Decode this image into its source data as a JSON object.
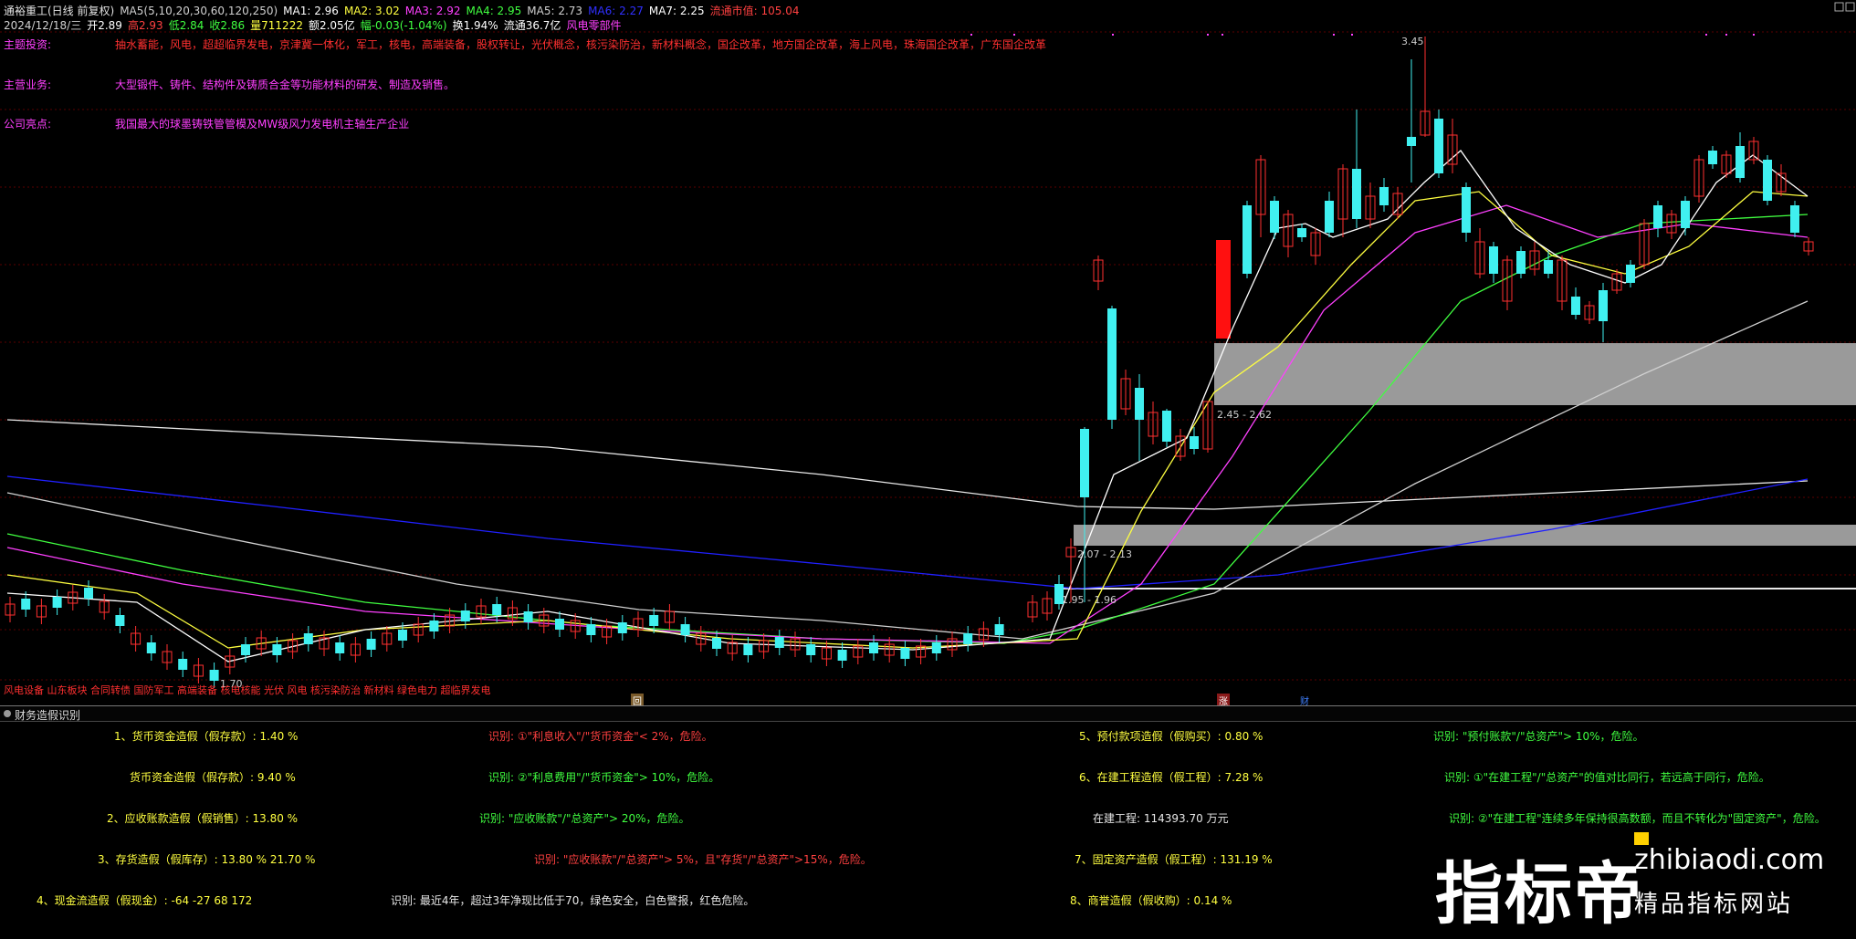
{
  "header": {
    "row1": [
      {
        "text": "通裕重工(日线 前复权)",
        "color": "#e0e0e0"
      },
      {
        "text": "MA5(5,10,20,30,60,120,250)",
        "color": "#d0d0d0"
      },
      {
        "text": "MA1: 2.96",
        "color": "#ffffff"
      },
      {
        "text": "MA2: 3.02",
        "color": "#ffff40"
      },
      {
        "text": "MA3: 2.92",
        "color": "#ff40ff"
      },
      {
        "text": "MA4: 2.95",
        "color": "#40ff40"
      },
      {
        "text": "MA5: 2.73",
        "color": "#d0d0d0"
      },
      {
        "text": "MA6: 2.27",
        "color": "#3030ff"
      },
      {
        "text": "MA7: 2.25",
        "color": "#ffffff"
      },
      {
        "text": "流通市值: 105.04",
        "color": "#ff4040"
      }
    ],
    "row2": [
      {
        "text": "2024/12/18/三",
        "color": "#d0d0d0"
      },
      {
        "text": "开2.89",
        "color": "#ffffff"
      },
      {
        "text": "高2.93",
        "color": "#ff4040"
      },
      {
        "text": "低2.84",
        "color": "#40ff40"
      },
      {
        "text": "收2.86",
        "color": "#40ff40"
      },
      {
        "text": "量711222",
        "color": "#ffff40"
      },
      {
        "text": "额2.05亿",
        "color": "#ffffff"
      },
      {
        "text": "幅-0.03(-1.04%)",
        "color": "#40ff40"
      },
      {
        "text": "换1.94%",
        "color": "#ffffff"
      },
      {
        "text": "流通36.7亿",
        "color": "#ffffff"
      },
      {
        "text": "风电零部件",
        "color": "#ff40ff"
      }
    ]
  },
  "info": {
    "theme_label": "主题投资:",
    "theme_text": "抽水蓄能，风电，超超临界发电，京津冀一体化，军工，核电，高端装备，股权转让，光伏概念，核污染防治，新材料概念，国企改革，地方国企改革，海上风电，珠海国企改革，广东国企改革",
    "business_label": "主营业务:",
    "business_text": "大型锻件、铸件、结构件及铸质合金等功能材料的研发、制造及销售。",
    "highlight_label": "公司亮点:",
    "highlight_text": "我国最大的球墨铸铁管管模及MW级风力发电机主轴生产企业"
  },
  "chart_tags": {
    "high": "3.45",
    "zone_upper": "2.45 - 2.62",
    "zone_middle": "2.07 - 2.13",
    "zone_lower": "1.95 - 1.96",
    "low": "1.70",
    "concepts": "风电设备 山东板块 合同转债 国防军工 高端装备 核电核能 光伏 风电 核污染防治 新材料 绿色电力 超临界发电",
    "tab_left": "回",
    "tab_mid": "涨",
    "tab_right": "财"
  },
  "finance": {
    "title": "财务造假识别",
    "r1c1": "1、货币资金造假（假存款）: 1.40 %",
    "r1c2": "识别: ①\"利息收入\"/\"货币资金\"< 2%，危险。",
    "r1c3": "5、预付款项造假（假购买）: 0.80 %",
    "r1c4": "识别: \"预付账款\"/\"总资产\"> 10%，危险。",
    "r2c1": "货币资金造假（假存款）: 9.40 %",
    "r2c2": "识别: ②\"利息费用\"/\"货币资金\"> 10%，危险。",
    "r2c3": "6、在建工程造假（假工程）: 7.28 %",
    "r2c4": "识别: ①\"在建工程\"/\"总资产\"的值对比同行，若远高于同行，危险。",
    "r3c1": "2、应收账款造假（假销售）: 13.80 %",
    "r3c2": "识别: \"应收账款\"/\"总资产\"> 20%，危险。",
    "r3c3": "在建工程: 114393.70 万元",
    "r3c4": "识别: ②\"在建工程\"连续多年保持很高数额，而且不转化为\"固定资产\"，危险。",
    "r4c1": "3、存货造假（假库存）: 13.80 %     21.70 %",
    "r4c2": "识别: \"应收账款\"/\"总资产\"> 5%，且\"存货\"/\"总资产\">15%，危险。",
    "r4c3": "7、固定资产造假（假工程）: 131.19 %",
    "r5c1": "4、现金流造假（假现金）: -64  -27  68  172",
    "r5c2": "识别: 最近4年，超过3年净现比低于70，绿色安全，白色警报，红色危险。",
    "r5c3": "8、商誉造假（假收购）: 0.14 %"
  },
  "watermark": {
    "cn": "指标帝",
    "url": "zhibiaodi.com",
    "sub": "精品指标网站"
  },
  "colors": {
    "up": "#ff3030",
    "down": "#40f0f0",
    "ma1": "#ffffff",
    "ma2": "#ffff40",
    "ma3": "#ff40ff",
    "ma4": "#40ff40",
    "ma6": "#2020ff",
    "zone": "#9a9a9a"
  }
}
